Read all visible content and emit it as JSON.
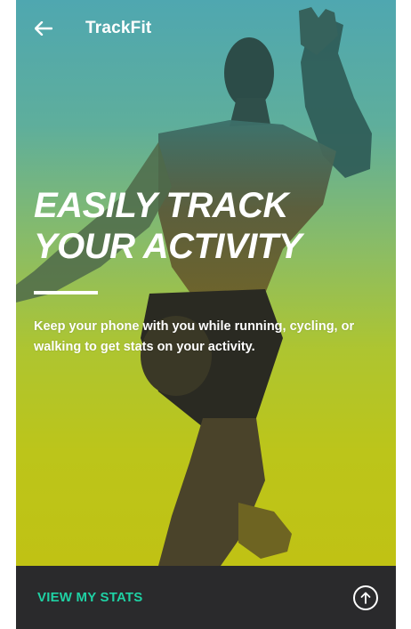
{
  "app": {
    "title": "TrackFit"
  },
  "hero": {
    "headline_line1": "EASILY TRACK",
    "headline_line2": "YOUR ACTIVITY",
    "description": "Keep your phone with you while running, cycling, or walking to get stats on your activity.",
    "image": "athlete-photo"
  },
  "footer": {
    "cta_label": "VIEW MY STATS",
    "icon": "arrow-up-circle-icon"
  },
  "colors": {
    "accent": "#1fd1a4",
    "bar_background": "#2a2a2c",
    "gradient_top": "#4fa7b0",
    "gradient_bottom": "#c0c214"
  }
}
